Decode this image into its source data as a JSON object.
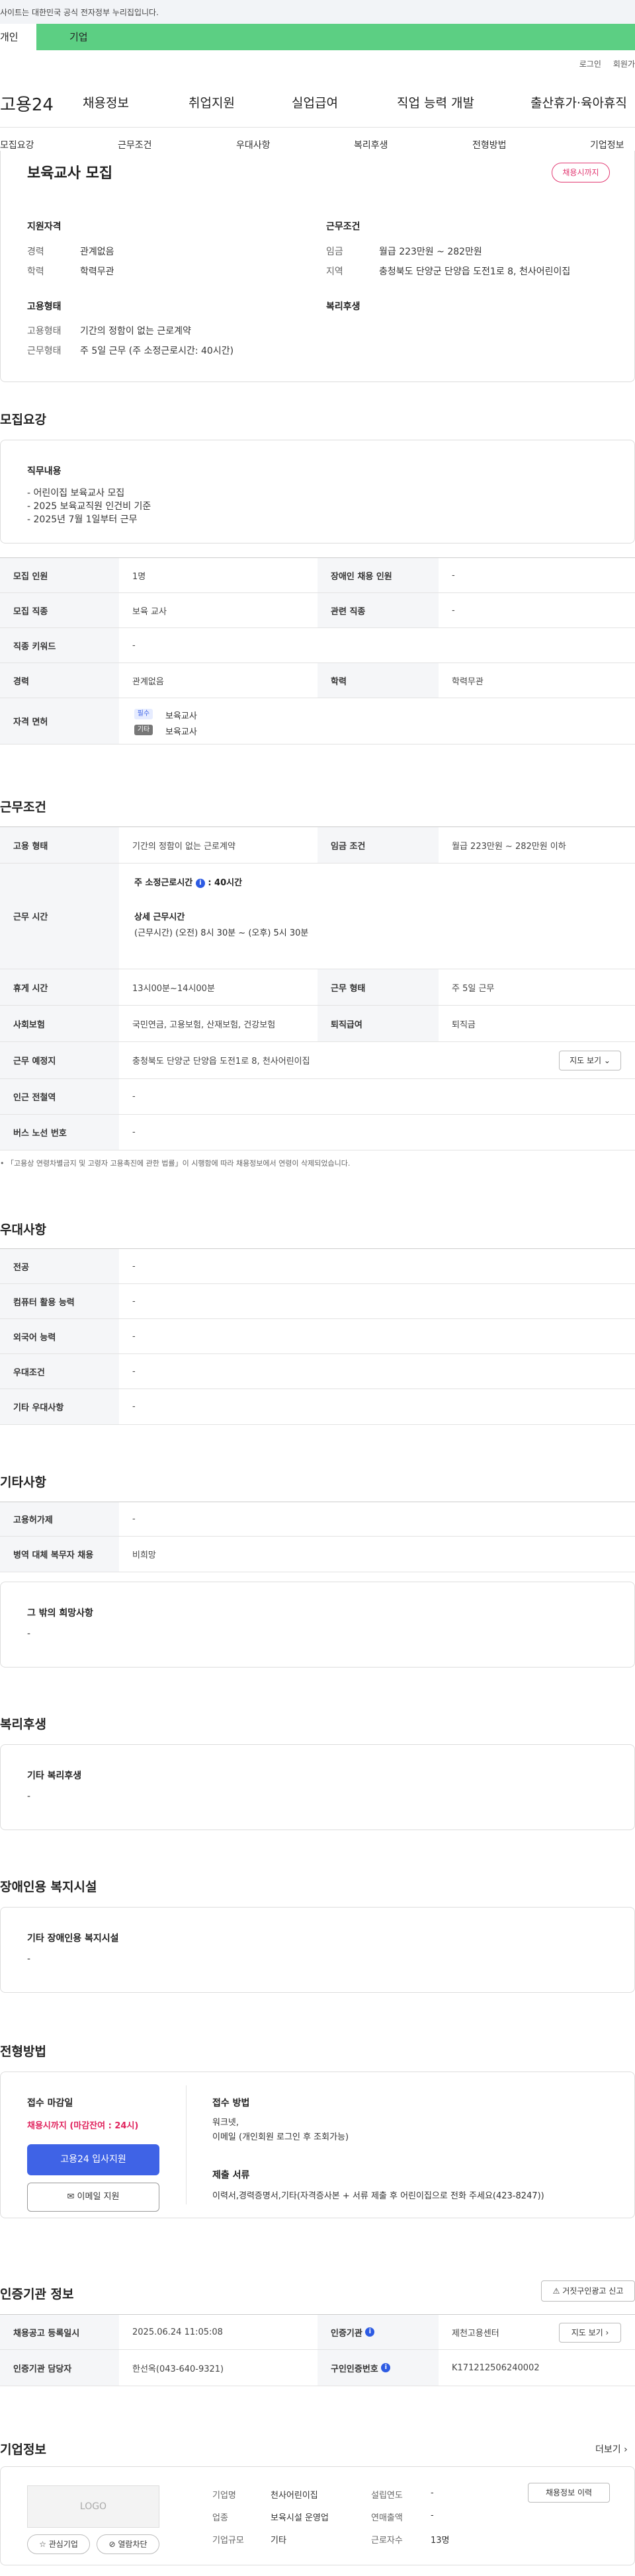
{
  "gov_banner": {
    "text": "사이트는 대한민국 공식 전자정부 누리집입니다."
  },
  "user_tabs": {
    "personal": "개인",
    "company": "기업"
  },
  "util": {
    "login": "로그인",
    "join": "회원가"
  },
  "brand": {
    "logo_text": "고용24"
  },
  "gnb": [
    "채용정보",
    "취업지원",
    "실업급여",
    "직업 능력 개발",
    "출산휴가·육아휴직"
  ],
  "lnb": [
    "모집요강",
    "근무조건",
    "우대사항",
    "복리후생",
    "전형방법",
    "기업정보"
  ],
  "summary": {
    "title": "보육교사 모집",
    "badge": "채용시까지",
    "qual_title": "지원자격",
    "career_label": "경력",
    "career": "관계없음",
    "edu_label": "학력",
    "edu": "학력무관",
    "cond_title": "근무조건",
    "wage_label": "임금",
    "wage": "월급 223만원 ~ 282만원",
    "area_label": "지역",
    "area": "충청북도 단양군 단양읍 도전1로 8, 천사어린이집",
    "emp_title": "고용형태",
    "emp_label": "고용형태",
    "emp": "기간의 정함이 없는 근로계약",
    "work_label": "근무형태",
    "work": "주 5일 근무 (주 소정근로시간: 40시간)",
    "welfare_title": "복리후생"
  },
  "recruit": {
    "heading": "모집요강",
    "duty_title": "직무내용",
    "duty_lines": [
      "- 어린이집 보육교사 모집",
      "- 2025 보육교직원 인건비 기준",
      "- 2025년 7월 1일부터 근무"
    ],
    "count_label": "모집 인원",
    "count": "1명",
    "disabled_label": "장애인 채용 인원",
    "disabled": "-",
    "job_label": "모집 직종",
    "job": "보육 교사",
    "related_label": "관련 직종",
    "related": "-",
    "keyword_label": "직종 키워드",
    "keyword": "-",
    "career_label": "경력",
    "career": "관계없음",
    "edu_label": "학력",
    "edu": "학력무관",
    "license_label": "자격 면허",
    "req_badge": "필수",
    "req_license": "보육교사",
    "etc_badge": "기타",
    "etc_license": "보육교사"
  },
  "conditions": {
    "heading": "근무조건",
    "emp_label": "고용 형태",
    "emp": "기간의 정함이 없는 근로계약",
    "wage_label": "임금 조건",
    "wage": "월급 223만원 ~ 282만원 이하",
    "time_label": "근무 시간",
    "weekly": "주 소정근로시간",
    "weekly_val": ": 40시간",
    "detail_title": "상세 근무시간",
    "detail": "(근무시간) (오전) 8시 30분 ~ (오후) 5시 30분",
    "break_label": "휴게 시간",
    "break": "13시00분~14시00분",
    "type_label": "근무 형태",
    "type": "주 5일 근무",
    "ins_label": "사회보험",
    "ins": "국민연금, 고용보험, 산재보험, 건강보험",
    "sev_label": "퇴직급여",
    "sev": "퇴직금",
    "place_label": "근무 예정지",
    "place": "충청북도 단양군 단양읍 도전1로 8, 천사어린이집",
    "map_btn": "지도 보기",
    "station_label": "인근 전철역",
    "station": "-",
    "bus_label": "버스 노선 번호",
    "bus": "-",
    "note": "「고용상 연령차별금지 및 고령자 고용촉진에 관한 법률」이 시행함에 따라 채용정보에서 연령이 삭제되었습니다."
  },
  "preferences": {
    "heading": "우대사항",
    "rows": [
      {
        "label": "전공",
        "value": "-"
      },
      {
        "label": "컴퓨터 활용 능력",
        "value": "-"
      },
      {
        "label": "외국어 능력",
        "value": "-"
      },
      {
        "label": "우대조건",
        "value": "-"
      },
      {
        "label": "기타 우대사항",
        "value": "-"
      }
    ]
  },
  "etc": {
    "heading": "기타사항",
    "rows": [
      {
        "label": "고용허가제",
        "value": "-"
      },
      {
        "label": "병역 대체 복무자 채용",
        "value": "비희망"
      }
    ],
    "hope_title": "그 밖의 희망사항",
    "hope": "-"
  },
  "welfare": {
    "heading": "복리후생",
    "title": "기타 복리후생",
    "value": "-"
  },
  "facility": {
    "heading": "장애인용 복지시설",
    "title": "기타 장애인용 복지시설",
    "value": "-"
  },
  "process": {
    "heading": "전형방법",
    "deadline_title": "접수 마감일",
    "deadline": "채용시까지 (마감잔여 : 24시)",
    "apply_btn": "고용24 입사지원",
    "email_btn": "이메일 지원",
    "method_title": "접수 방법",
    "method_lines": [
      "워크넷,",
      "이메일 (개인회원 로그인 후 조회가능)"
    ],
    "docs_title": "제출 서류",
    "docs": "이력서,경력증명서,기타(자격증사본 + 서류 제출 후 어린이집으로 전화 주세요(423-8247))"
  },
  "agency": {
    "heading": "인증기관 정보",
    "report_btn": "거짓구인광고 신고",
    "date_label": "채용공고 등록일시",
    "date": "2025.06.24 11:05:08",
    "org_label": "인증기관",
    "org": "제천고용센터",
    "map_btn": "지도 보기",
    "staff_label": "인증기관 담당자",
    "staff": "한선옥(043-640-9321)",
    "no_label": "구인인증번호",
    "no": "K171212506240002"
  },
  "company": {
    "heading": "기업정보",
    "more": "더보기",
    "logo": "LOGO",
    "fav_btn": "관심기업",
    "block_btn": "열람차단",
    "name_label": "기업명",
    "name": "천사어린이집",
    "est_label": "설립연도",
    "est": "-",
    "hist_btn": "채용정보 이력",
    "ind_label": "업종",
    "ind": "보육시설 운영업",
    "sales_label": "연매출액",
    "sales": "-",
    "size_label": "기업규모",
    "size": "기타",
    "emp_label": "근로자수",
    "emp": "13명"
  },
  "colors": {
    "green": "#5ccf83",
    "blue": "#3f63e6",
    "red": "#e0245e",
    "pink": "#e23a73"
  }
}
